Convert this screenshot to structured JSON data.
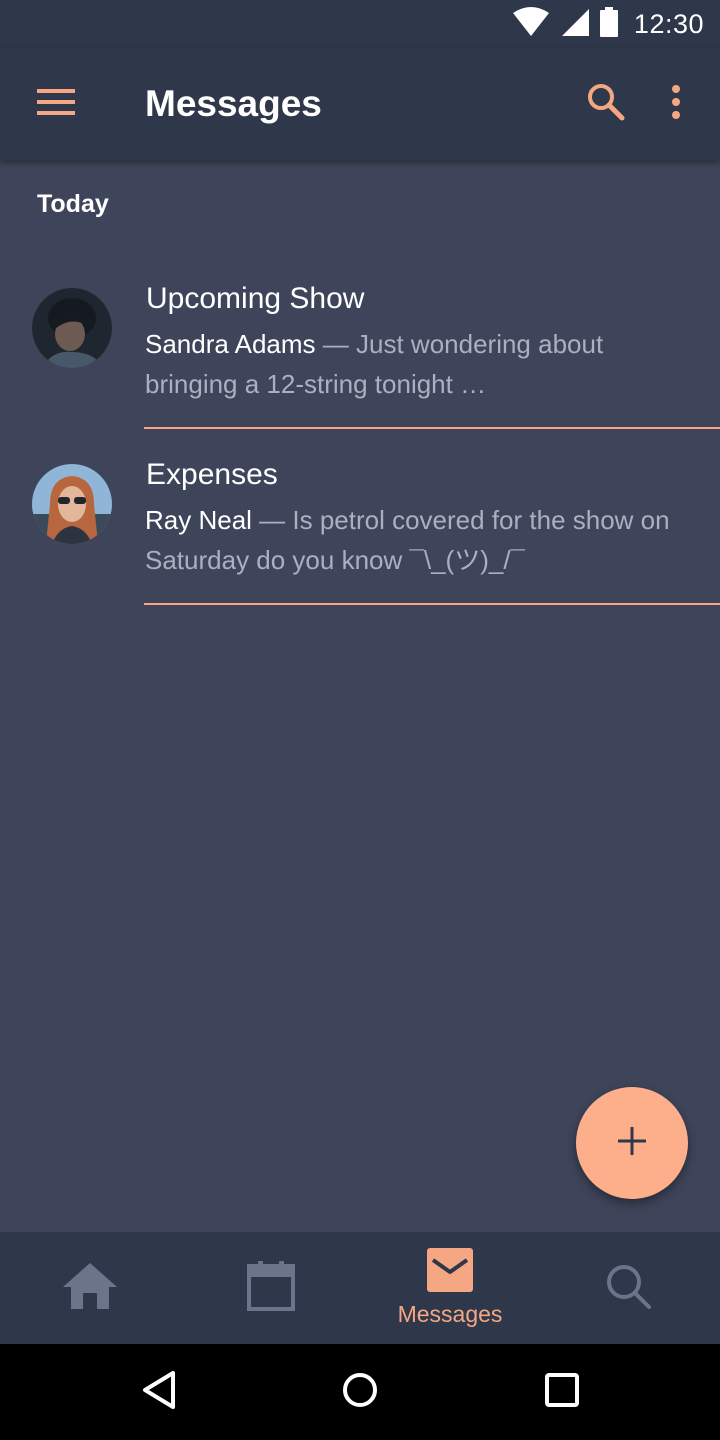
{
  "status_bar": {
    "time": "12:30",
    "icons": [
      "wifi-icon",
      "cell-signal-icon",
      "battery-icon"
    ]
  },
  "app_bar": {
    "title": "Messages",
    "icons": [
      "menu-icon",
      "search-icon",
      "more-vert-icon"
    ]
  },
  "section": {
    "header": "Today"
  },
  "messages": [
    {
      "subject": "Upcoming Show",
      "sender": "Sandra Adams",
      "separator": " — ",
      "preview": "Just wondering about bringing a 12-string tonight …"
    },
    {
      "subject": "Expenses",
      "sender": "Ray Neal",
      "separator": " — ",
      "preview": "Is petrol covered for the show on Saturday do you know ¯\\_(ツ)_/¯"
    }
  ],
  "fab": {
    "icon": "plus-icon"
  },
  "bottom_nav": {
    "items": [
      {
        "icon": "home-icon",
        "label": ""
      },
      {
        "icon": "calendar-icon",
        "label": ""
      },
      {
        "icon": "mail-icon",
        "label": "Messages",
        "active": true
      },
      {
        "icon": "search-icon",
        "label": ""
      }
    ]
  },
  "system_nav": {
    "icons": [
      "back-icon",
      "home-circle-icon",
      "recents-icon"
    ]
  },
  "colors": {
    "background": "#3e455a",
    "bar": "#2f374a",
    "accent": "#f5a783",
    "fab": "#fdaf8c",
    "secondary_text": "#a9b0c0",
    "inactive_icon": "#6b7488"
  }
}
